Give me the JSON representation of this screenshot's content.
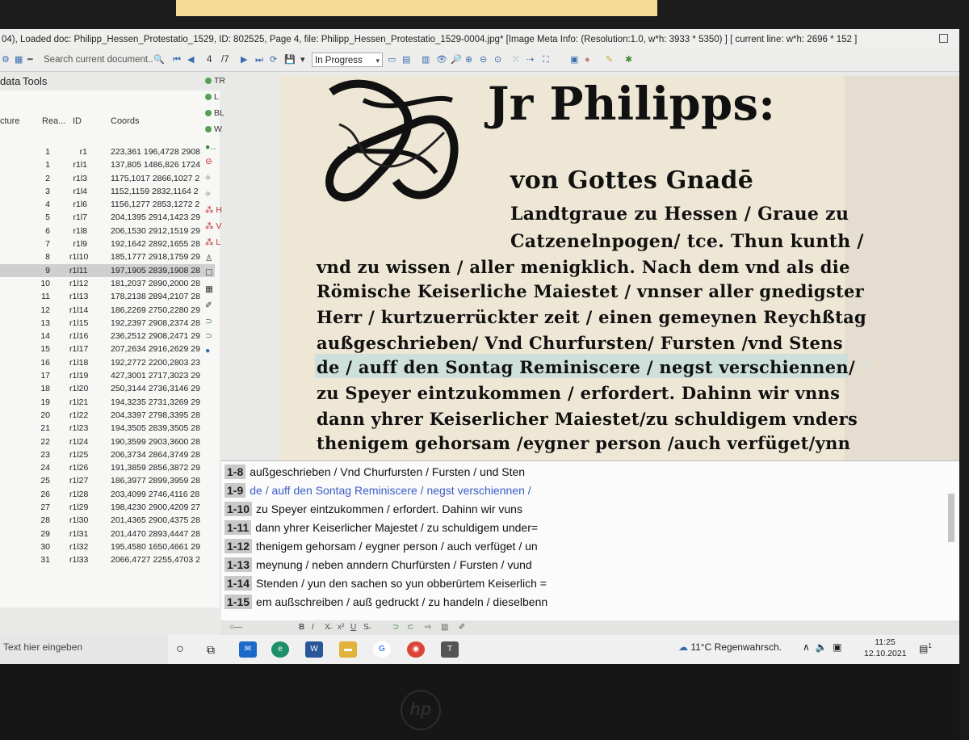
{
  "window": {
    "title": "04), Loaded doc: Philipp_Hessen_Protestatio_1529, ID: 802525, Page 4, file: Philipp_Hessen_Protestatio_1529-0004.jpg* [Image Meta Info: (Resolution:1.0, w*h: 3933 * 5350) ] [ current line: w*h: 2696 * 152 ]"
  },
  "toolbar": {
    "search_placeholder": "Search current document...",
    "page_current": "4",
    "page_total": "/7",
    "status": "In Progress"
  },
  "menubar": {
    "data": "data",
    "tools": "Tools"
  },
  "table": {
    "headers": {
      "structure": "cture",
      "reading_order": "Rea...",
      "id": "ID",
      "coords": "Coords"
    },
    "rows": [
      {
        "ro": "1",
        "id": "r1",
        "coords": "223,361 196,4728 2908"
      },
      {
        "ro": "1",
        "id": "r1l1",
        "coords": "137,805 1486,826 1724"
      },
      {
        "ro": "2",
        "id": "r1l3",
        "coords": "1175,1017 2866,1027 2"
      },
      {
        "ro": "3",
        "id": "r1l4",
        "coords": "1152,1159 2832,1164 2"
      },
      {
        "ro": "4",
        "id": "r1l6",
        "coords": "1156,1277 2853,1272 2"
      },
      {
        "ro": "5",
        "id": "r1l7",
        "coords": "204,1395 2914,1423 29"
      },
      {
        "ro": "6",
        "id": "r1l8",
        "coords": "206,1530 2912,1519 29"
      },
      {
        "ro": "7",
        "id": "r1l9",
        "coords": "192,1642 2892,1655 28"
      },
      {
        "ro": "8",
        "id": "r1l10",
        "coords": "185,1777 2918,1759 29"
      },
      {
        "ro": "9",
        "id": "r1l11",
        "coords": "197,1905 2839,1908 28"
      },
      {
        "ro": "10",
        "id": "r1l12",
        "coords": "181,2037 2890,2000 28"
      },
      {
        "ro": "11",
        "id": "r1l13",
        "coords": "178,2138 2894,2107 28"
      },
      {
        "ro": "12",
        "id": "r1l14",
        "coords": "186,2269 2750,2280 29"
      },
      {
        "ro": "13",
        "id": "r1l15",
        "coords": "192,2397 2908,2374 28"
      },
      {
        "ro": "14",
        "id": "r1l16",
        "coords": "236,2512 2908,2471 29"
      },
      {
        "ro": "15",
        "id": "r1l17",
        "coords": "207,2634 2916,2629 29"
      },
      {
        "ro": "16",
        "id": "r1l18",
        "coords": "192,2772 2200,2803 23"
      },
      {
        "ro": "17",
        "id": "r1l19",
        "coords": "427,3001 2717,3023 29"
      },
      {
        "ro": "18",
        "id": "r1l20",
        "coords": "250,3144 2736,3146 29"
      },
      {
        "ro": "19",
        "id": "r1l21",
        "coords": "194,3235 2731,3269 29"
      },
      {
        "ro": "20",
        "id": "r1l22",
        "coords": "204,3397 2798,3395 28"
      },
      {
        "ro": "21",
        "id": "r1l23",
        "coords": "194,3505 2839,3505 28"
      },
      {
        "ro": "22",
        "id": "r1l24",
        "coords": "190,3599 2903,3600 28"
      },
      {
        "ro": "23",
        "id": "r1l25",
        "coords": "206,3734 2864,3749 28"
      },
      {
        "ro": "24",
        "id": "r1l26",
        "coords": "191,3859 2856,3872 29"
      },
      {
        "ro": "25",
        "id": "r1l27",
        "coords": "186,3977 2899,3959 28"
      },
      {
        "ro": "26",
        "id": "r1l28",
        "coords": "203,4099 2746,4116 28"
      },
      {
        "ro": "27",
        "id": "r1l29",
        "coords": "198,4230 2900,4209 27"
      },
      {
        "ro": "28",
        "id": "r1l30",
        "coords": "201,4365 2900,4375 28"
      },
      {
        "ro": "29",
        "id": "r1l31",
        "coords": "201,4470 2893,4447 28"
      },
      {
        "ro": "30",
        "id": "r1l32",
        "coords": "195,4580 1650,4661 29"
      },
      {
        "ro": "31",
        "id": "r1l33",
        "coords": "2066,4727 2255,4703 2"
      }
    ]
  },
  "side_icons": {
    "tr": "TR",
    "l": "L",
    "bl": "BL",
    "w": "W",
    "h": "H",
    "v": "V",
    "l2": "L"
  },
  "scan_lines": [
    "Jr Philipps:",
    "von Gottes Gnadē",
    "Landtgraue zu Hessen / Graue zu",
    "Catzenelnpogen/ tce. Thun kunth /",
    "vnd zu wissen / aller menigklich. Nach dem vnd als die",
    "Römische Keiserliche Maiestet / vnnser aller gnedigster",
    "Herr / kurtzuerrückter zeit / einen gemeynen Reychßtag",
    "außgeschrieben/ Vnd Churfursten/ Fursten /vnd Stens",
    "de / auff den Sontag Reminiscere / negst verschiennen/",
    "zu Speyer eintzukommen / erfordert. Dahinn wir vnns",
    "dann yhrer Keiserlicher Maiestet/zu schuldigem vnders",
    "thenigem gehorsam /eygner person /auch verfüget/ynn"
  ],
  "transcription": [
    {
      "num": "1-8",
      "text": "außgeschrieben / Vnd Churfursten / Fursten / und Sten"
    },
    {
      "num": "1-9",
      "text": "de / auff den Sontag Reminiscere / negst verschiennen /"
    },
    {
      "num": "1-10",
      "text": "zu Speyer eintzukommen / erfordert. Dahinn wir vuns"
    },
    {
      "num": "1-11",
      "text": "dann yhrer Keiserlicher Majestet / zu schuldigem under="
    },
    {
      "num": "1-12",
      "text": "thenigem gehorsam / eygner person / auch verfüget / un"
    },
    {
      "num": "1-13",
      "text": "meynung / neben anndern Churfürsten / Fursten / vund"
    },
    {
      "num": "1-14",
      "text": "Stenden / yun den sachen so yun obberürtem Keiserlich ="
    },
    {
      "num": "1-15",
      "text": "em außschreiben / auß gedruckt / zu handeln / dieselbenn"
    }
  ],
  "taskbar": {
    "search_placeholder": "Text hier eingeben",
    "weather": "11°C Regenwahrsch.",
    "time": "11:25",
    "date": "12.10.2021",
    "notifications": "1"
  },
  "brand": "hp"
}
